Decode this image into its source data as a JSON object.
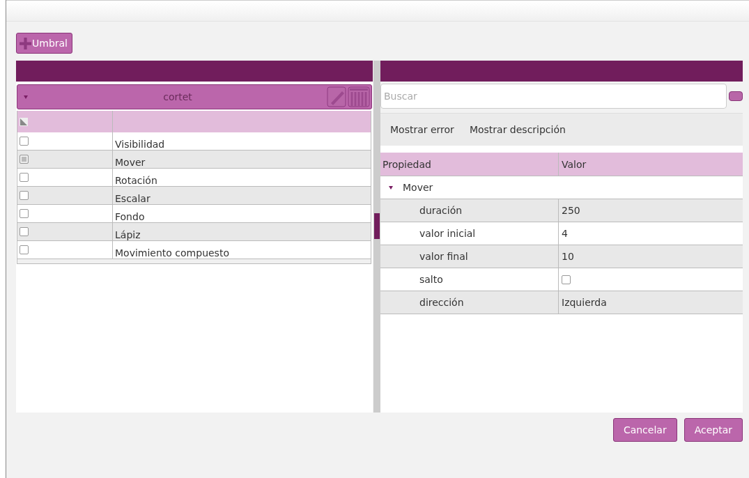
{
  "toolbar": {
    "add_button": "Umbral"
  },
  "effects_panel": {
    "group": {
      "title": "cortet",
      "expanded": true
    },
    "rows": [
      {
        "label": "Visibilidad",
        "checked": false
      },
      {
        "label": "Mover",
        "checked": true
      },
      {
        "label": "Rotación",
        "checked": false
      },
      {
        "label": "Escalar",
        "checked": false
      },
      {
        "label": "Fondo",
        "checked": false
      },
      {
        "label": "Lápiz",
        "checked": false
      },
      {
        "label": "Movimiento compuesto",
        "checked": false
      }
    ]
  },
  "properties_panel": {
    "search": {
      "placeholder": "Buscar"
    },
    "actions": [
      "Mostrar error",
      "Mostrar descripción"
    ],
    "columns": [
      "Propiedad",
      "Valor"
    ],
    "groups": [
      {
        "name": "Mover",
        "expanded": true,
        "children": [
          {
            "name": "duración",
            "kind": "text",
            "value": "250"
          },
          {
            "name": "valor inicial",
            "kind": "text",
            "value": "4"
          },
          {
            "name": "valor final",
            "kind": "text",
            "value": "10"
          },
          {
            "name": "salto",
            "kind": "checkbox",
            "checked": false
          },
          {
            "name": "dirección",
            "kind": "text",
            "value": "Izquierda"
          }
        ]
      }
    ]
  },
  "buttons": [
    "Cancelar",
    "Aceptar"
  ]
}
